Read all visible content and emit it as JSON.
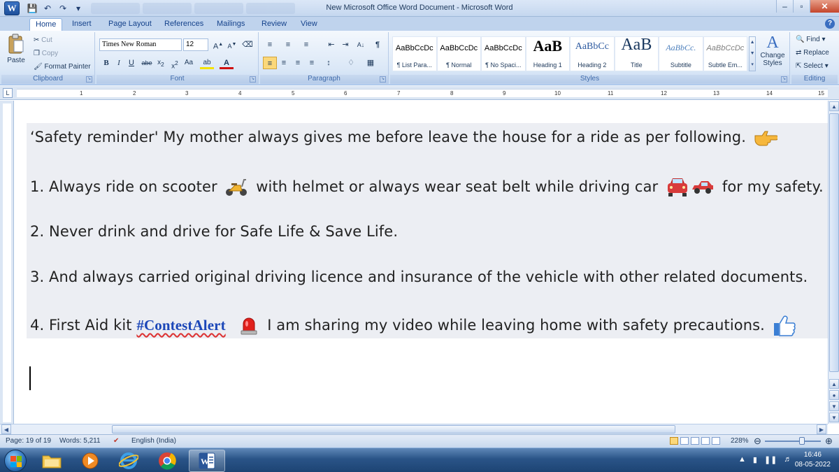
{
  "window": {
    "title": "New Microsoft Office Word Document - Microsoft Word",
    "logo_letter": "W",
    "controls": {
      "minimize": "–",
      "maximize": "▫",
      "close": "✕"
    },
    "qat": [
      "save-icon",
      "undo-icon",
      "redo-icon",
      "customize-icon"
    ]
  },
  "ribbon": {
    "tabs": [
      "Home",
      "Insert",
      "Page Layout",
      "References",
      "Mailings",
      "Review",
      "View"
    ],
    "active_tab": "Home",
    "clipboard": {
      "paste": "Paste",
      "cut": "Cut",
      "copy": "Copy",
      "format_painter": "Format Painter",
      "label": "Clipboard"
    },
    "font": {
      "name": "Times New Roman",
      "size": "12",
      "label": "Font"
    },
    "paragraph": {
      "label": "Paragraph"
    },
    "styles": {
      "label": "Styles",
      "tiles": [
        {
          "sample": "AaBbCcDc",
          "name": "¶ List Para..."
        },
        {
          "sample": "AaBbCcDc",
          "name": "¶ Normal"
        },
        {
          "sample": "AaBbCcDc",
          "name": "¶ No Spaci..."
        },
        {
          "sample": "AaB",
          "name": "Heading 1"
        },
        {
          "sample": "AaBbCc",
          "name": "Heading 2"
        },
        {
          "sample": "AaB",
          "name": "Title"
        },
        {
          "sample": "AaBbCc.",
          "name": "Subtitle"
        },
        {
          "sample": "AaBbCcDc",
          "name": "Subtle Em..."
        }
      ],
      "change_styles": "Change Styles"
    },
    "editing": {
      "find": "Find",
      "replace": "Replace",
      "select": "Select",
      "label": "Editing"
    }
  },
  "ruler": {
    "numbers": [
      "1",
      "2",
      "3",
      "4",
      "5",
      "6",
      "7",
      "8",
      "9",
      "10",
      "11",
      "12",
      "13",
      "14",
      "15"
    ],
    "tab_selector": "L"
  },
  "document": {
    "line1": "‘Safety reminder' My mother always gives me before leave the house for a ride as per following.",
    "line2a": "1. Always ride on scooter",
    "line2b": "with helmet or always wear seat belt while driving car",
    "line2c": "for my safety.",
    "line3": "2. Never drink and drive for Safe Life & Save Life.",
    "line4": "3. And always carried original driving licence and insurance of the vehicle with other related documents.",
    "line5a": "4. First Aid kit",
    "hashtag": "#ContestAlert",
    "line5b": "I am sharing my video while leaving home with safety precautions."
  },
  "status": {
    "page": "Page: 19 of 19",
    "words": "Words: 5,211",
    "language": "English (India)",
    "zoom": "228%"
  },
  "taskbar": {
    "time": "16:46",
    "date": "08-05-2022"
  },
  "colors": {
    "accent": "#15428b",
    "hashtag": "#1c47b8",
    "shade": "#eceef3"
  }
}
